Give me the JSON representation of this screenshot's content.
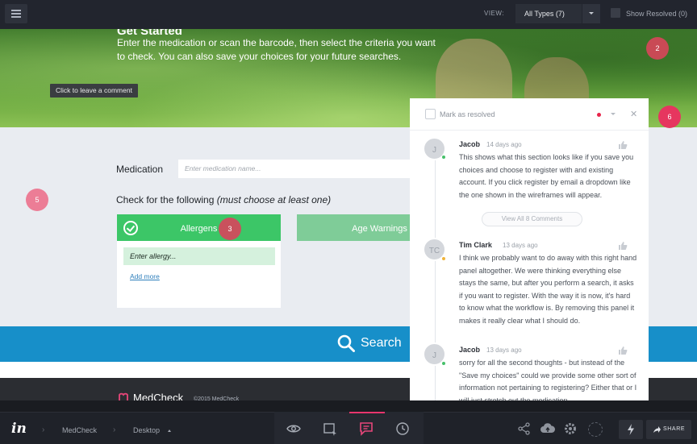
{
  "topbar": {
    "view_label": "VIEW:",
    "types_value": "All Types (7)",
    "show_resolved_label": "Show Resolved (0)"
  },
  "hero": {
    "title": "Get Started",
    "description": "Enter the medication or scan the barcode, then select the criteria you want to check. You can also save your choices for your future searches.",
    "tooltip": "Click to leave a comment"
  },
  "form": {
    "medication_label": "Medication",
    "medication_placeholder": "Enter medication name...",
    "check_label": "Check for the following",
    "check_hint": "(must choose at least one)",
    "allergens_label": "Allergens",
    "allergy_input_placeholder": "Enter allergy...",
    "add_more": "Add more",
    "age_warnings_label": "Age Warnings",
    "search_label": "Search"
  },
  "pins": [
    "2",
    "3",
    "5",
    "6"
  ],
  "footer": {
    "brand": "MedCheck",
    "copyright": "©2015 MedCheck"
  },
  "panel": {
    "mark_resolved": "Mark as resolved",
    "close": "✕",
    "view_all": "View All 8 Comments",
    "comments": [
      {
        "initials": "J",
        "author": "Jacob",
        "time": "14 days ago",
        "text": "This shows what this section looks like if you save you choices and choose to register with and existing account. If you click register by email a dropdown like the one shown in the wireframes will appear.",
        "status_color": "#46c06a"
      },
      {
        "initials": "TC",
        "author": "Tim Clark",
        "time": "13 days ago",
        "text": "I think we probably want to do away with this right hand panel altogether. We were thinking everything else stays the same, but after you perform a search, it asks if you want to register. With the way it is now, it's hard to know what the workflow is. By removing this panel it makes it really clear what I should do.",
        "status_color": "#f0b43a"
      },
      {
        "initials": "J",
        "author": "Jacob",
        "time": "13 days ago",
        "text": "sorry for all the second thoughts - but instead of the \"Save my choices\" could we provide some other sort of information not pertaining to registering? Either that or I will just stretch out the medication",
        "status_color": "#46c06a"
      }
    ]
  },
  "bottombar": {
    "brand": "in",
    "project": "MedCheck",
    "screen": "Desktop",
    "share_label": "SHARE"
  },
  "colors": {
    "pin_pink": "#e8467a",
    "accent_green": "#3cc667",
    "search_blue": "#178fc9"
  }
}
